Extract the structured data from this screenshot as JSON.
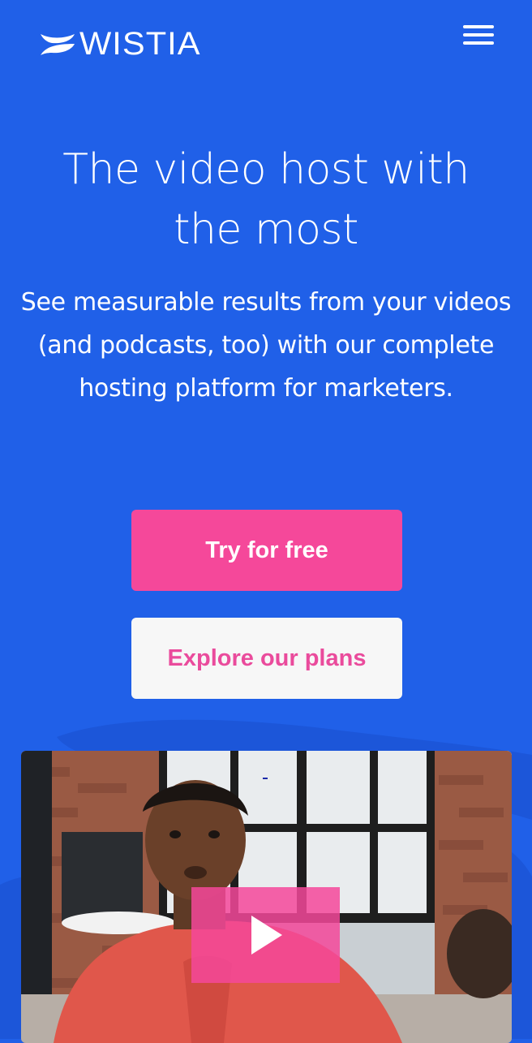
{
  "brand": {
    "name": "WISTIA",
    "accent": "#2060e8",
    "primary_button_color": "#f5489a",
    "secondary_button_text_color": "#ea4b9c"
  },
  "header": {
    "logo_icon": "wistia-logo-icon",
    "menu_icon": "hamburger-menu-icon"
  },
  "hero": {
    "headline": "The video host with the most",
    "subheadline": "See measurable results from your videos (and podcasts, too) with our complete hosting platform for marketers."
  },
  "cta": {
    "primary_label": "Try for free",
    "secondary_label": "Explore our plans"
  },
  "video": {
    "play_icon": "play-icon",
    "thumbnail_description_icon": "video-thumbnail"
  }
}
